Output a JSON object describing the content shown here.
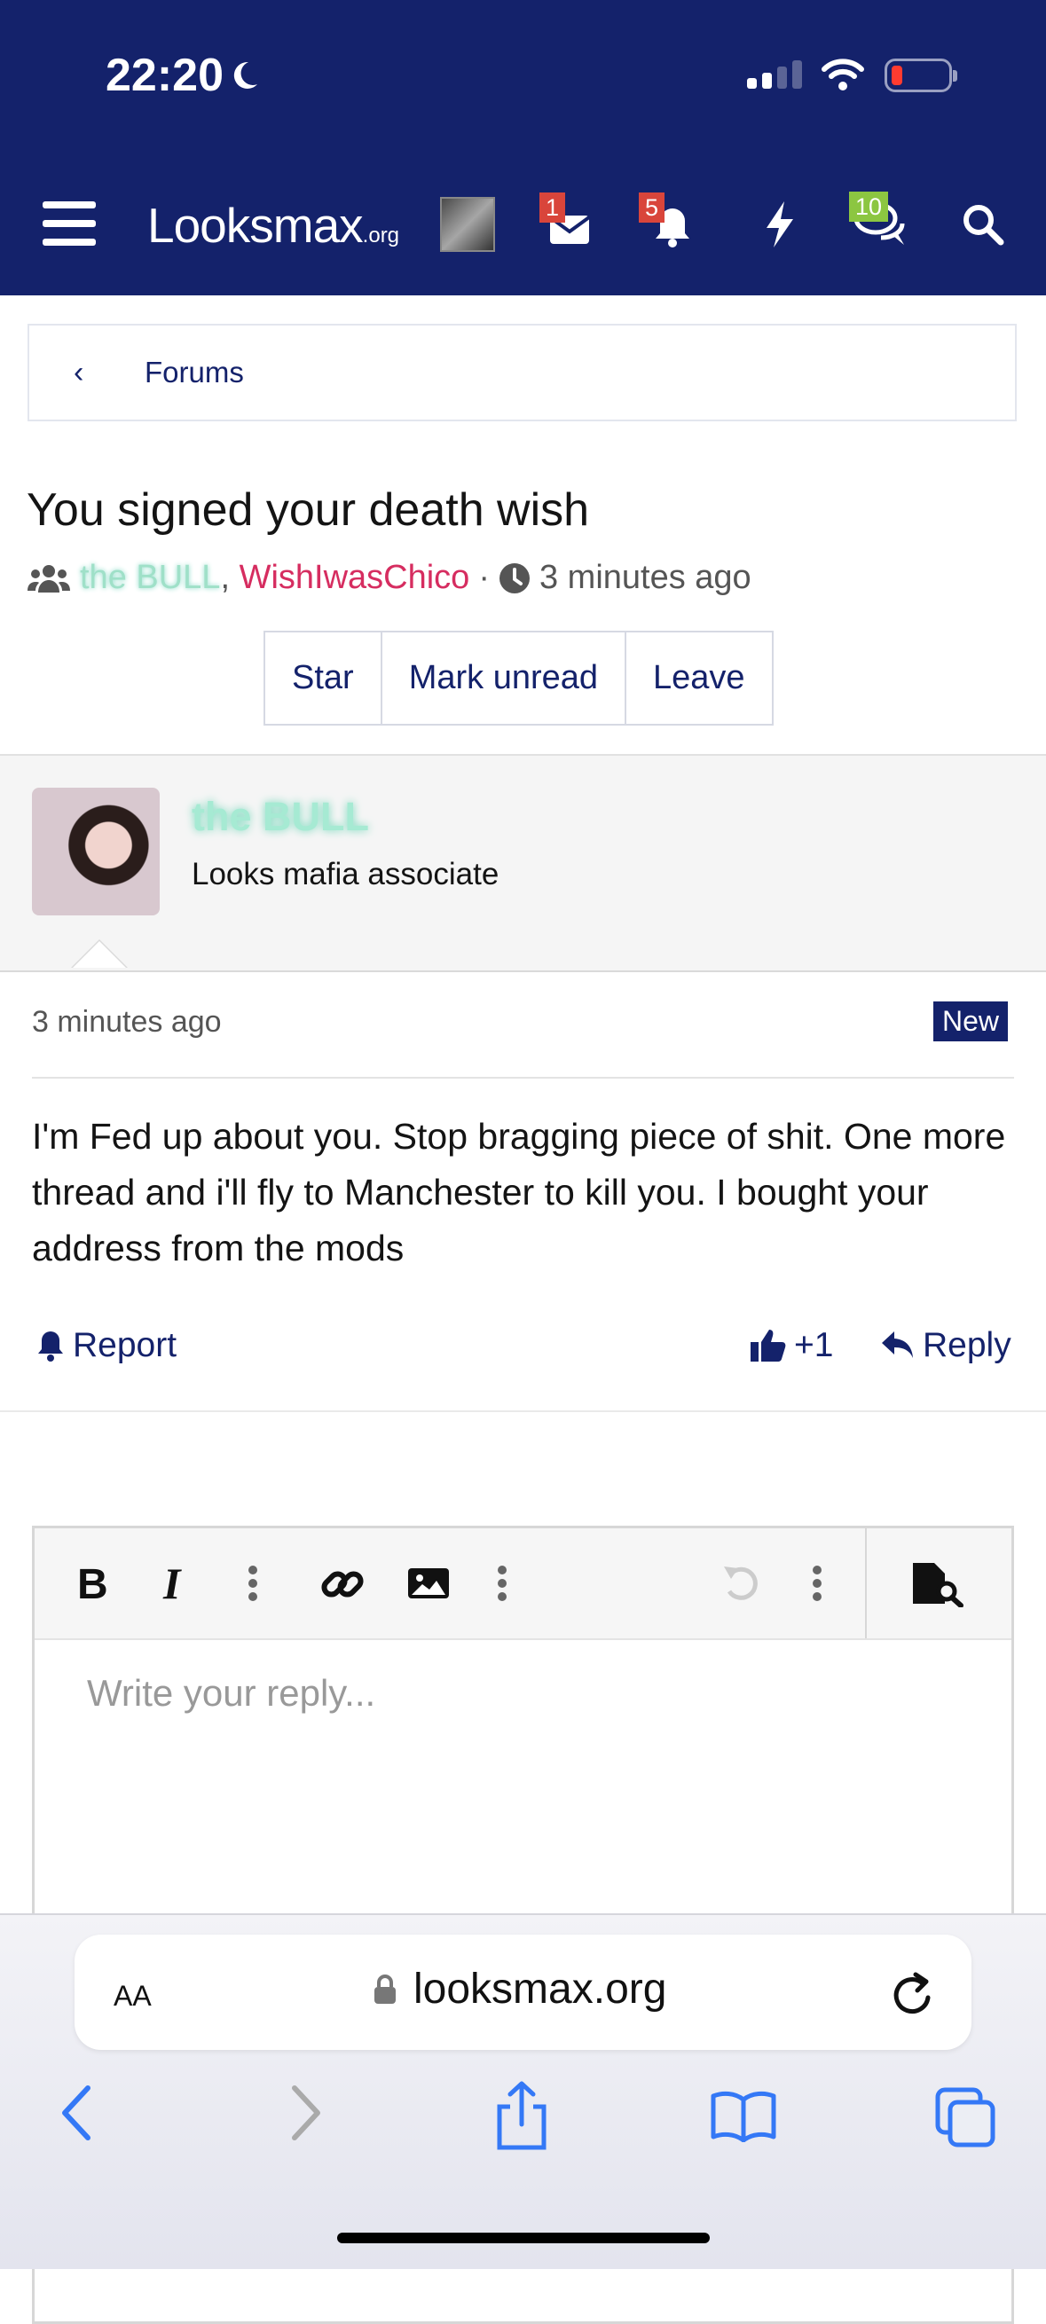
{
  "status_bar": {
    "time": "22:20",
    "icons": [
      "moon-icon",
      "cellular-signal-icon",
      "wifi-icon",
      "battery-low-icon"
    ]
  },
  "header": {
    "logo_main": "Looksmax",
    "logo_suffix": ".org",
    "badges": {
      "inbox": "1",
      "alerts": "5",
      "chats": "10"
    },
    "icons": [
      "menu-icon",
      "user-avatar",
      "inbox-icon",
      "bell-icon",
      "bolt-icon",
      "comments-icon",
      "search-icon"
    ],
    "colors": {
      "bg": "#14226b",
      "badge_red": "#d9453b",
      "badge_green": "#8cc641"
    }
  },
  "breadcrumb": {
    "label": "Forums"
  },
  "conversation": {
    "title": "You signed your death wish",
    "participants": [
      "the BULL",
      "WishIwasChico"
    ],
    "separator": ",",
    "dot": "·",
    "time": "3 minutes ago",
    "buttons": {
      "star": "Star",
      "mark_unread": "Mark unread",
      "leave": "Leave"
    }
  },
  "message": {
    "author": "the BULL",
    "author_title": "Looks mafia associate",
    "time": "3 minutes ago",
    "new_badge": "New",
    "body": "I'm Fed up about you. Stop bragging piece of shit. One more thread and i'll fly to Manchester to kill you. I bought your address from the mods",
    "actions": {
      "report": "Report",
      "like": "+1",
      "reply": "Reply"
    }
  },
  "editor": {
    "placeholder": "Write your reply...",
    "toolbar": [
      "bold-icon",
      "italic-icon",
      "more-vertical-icon",
      "link-icon",
      "image-icon",
      "more-vertical-icon",
      "undo-icon",
      "more-vertical-icon",
      "preview-icon"
    ]
  },
  "safari": {
    "aa": "AA",
    "url": "looksmax.org",
    "nav_icons": [
      "back-icon",
      "forward-icon",
      "share-icon",
      "bookmarks-icon",
      "tabs-icon"
    ]
  }
}
